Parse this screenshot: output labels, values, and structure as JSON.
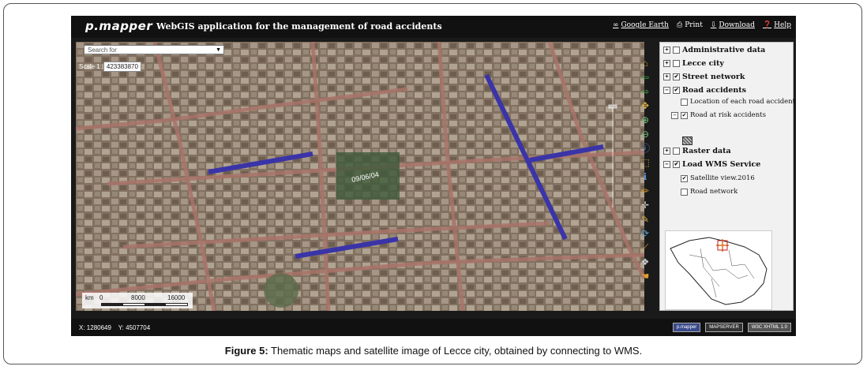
{
  "header": {
    "logo": "p.mapper",
    "title": "WebGIS application for the management of road accidents",
    "links": [
      {
        "label": "Google Earth",
        "icon": "globe-icon"
      },
      {
        "label": "Print",
        "icon": "print-icon"
      },
      {
        "label": "Download",
        "icon": "download-icon"
      },
      {
        "label": "Help",
        "icon": "help-icon"
      }
    ]
  },
  "map": {
    "search_placeholder": "Search for",
    "scale_label": "Scale 1:",
    "scale_value": "423383870",
    "date_stamp": "09/06/04",
    "scalebar": {
      "unit": "km",
      "ticks": [
        "0",
        "8000",
        "16000"
      ]
    },
    "highlight_color": "#3a34a8"
  },
  "toolbar": {
    "tools": [
      {
        "name": "home-icon",
        "glyph": "⌂"
      },
      {
        "name": "back-arrow-icon",
        "glyph": "⇦"
      },
      {
        "name": "forward-arrow-icon",
        "glyph": "⇨"
      },
      {
        "name": "pan-icon",
        "glyph": "✥"
      },
      {
        "name": "zoom-in-icon",
        "glyph": "⊕"
      },
      {
        "name": "zoom-out-icon",
        "glyph": "⊖"
      },
      {
        "name": "identify-icon",
        "glyph": "ⓘ"
      },
      {
        "name": "select-icon",
        "glyph": "⬚"
      },
      {
        "name": "info-icon",
        "glyph": "ℹ"
      },
      {
        "name": "measure-icon",
        "glyph": "📏"
      },
      {
        "name": "coordinates-icon",
        "glyph": "✛"
      },
      {
        "name": "paint-icon",
        "glyph": "✎"
      },
      {
        "name": "refresh-icon",
        "glyph": "⟳"
      },
      {
        "name": "ruler-icon",
        "glyph": "⟋"
      },
      {
        "name": "layers-icon",
        "glyph": "❖"
      },
      {
        "name": "hand-icon",
        "glyph": "☚"
      }
    ]
  },
  "toc": {
    "items": [
      {
        "label": "Administrative data",
        "level": 0,
        "checked": false,
        "expander": "+"
      },
      {
        "label": "Lecce city",
        "level": 0,
        "checked": false,
        "expander": "+"
      },
      {
        "label": "Street network",
        "level": 0,
        "checked": true,
        "expander": "+"
      },
      {
        "label": "Road accidents",
        "level": 0,
        "checked": true,
        "expander": "−"
      },
      {
        "label": "Location of each road accident",
        "level": 1,
        "checked": false,
        "expander": ""
      },
      {
        "label": "Road at risk accidents",
        "level": 1,
        "checked": true,
        "expander": "−"
      },
      {
        "label": "Raster data",
        "level": 0,
        "checked": false,
        "expander": "+"
      },
      {
        "label": "Load WMS Service",
        "level": 0,
        "checked": true,
        "expander": "−"
      },
      {
        "label": "Satellite view.2016",
        "level": 1,
        "checked": true,
        "expander": ""
      },
      {
        "label": "Road network",
        "level": 1,
        "checked": false,
        "expander": ""
      }
    ]
  },
  "status": {
    "x_label": "X:",
    "x_value": "1280649",
    "y_label": "Y:",
    "y_value": "4507704",
    "badges": [
      "p.mapper",
      "MAPSERVER",
      "W3C XHTML 1.0"
    ]
  },
  "caption": {
    "label": "Figure 5:",
    "text": " Thematic maps and satellite image of Lecce city, obtained by connecting to WMS."
  }
}
